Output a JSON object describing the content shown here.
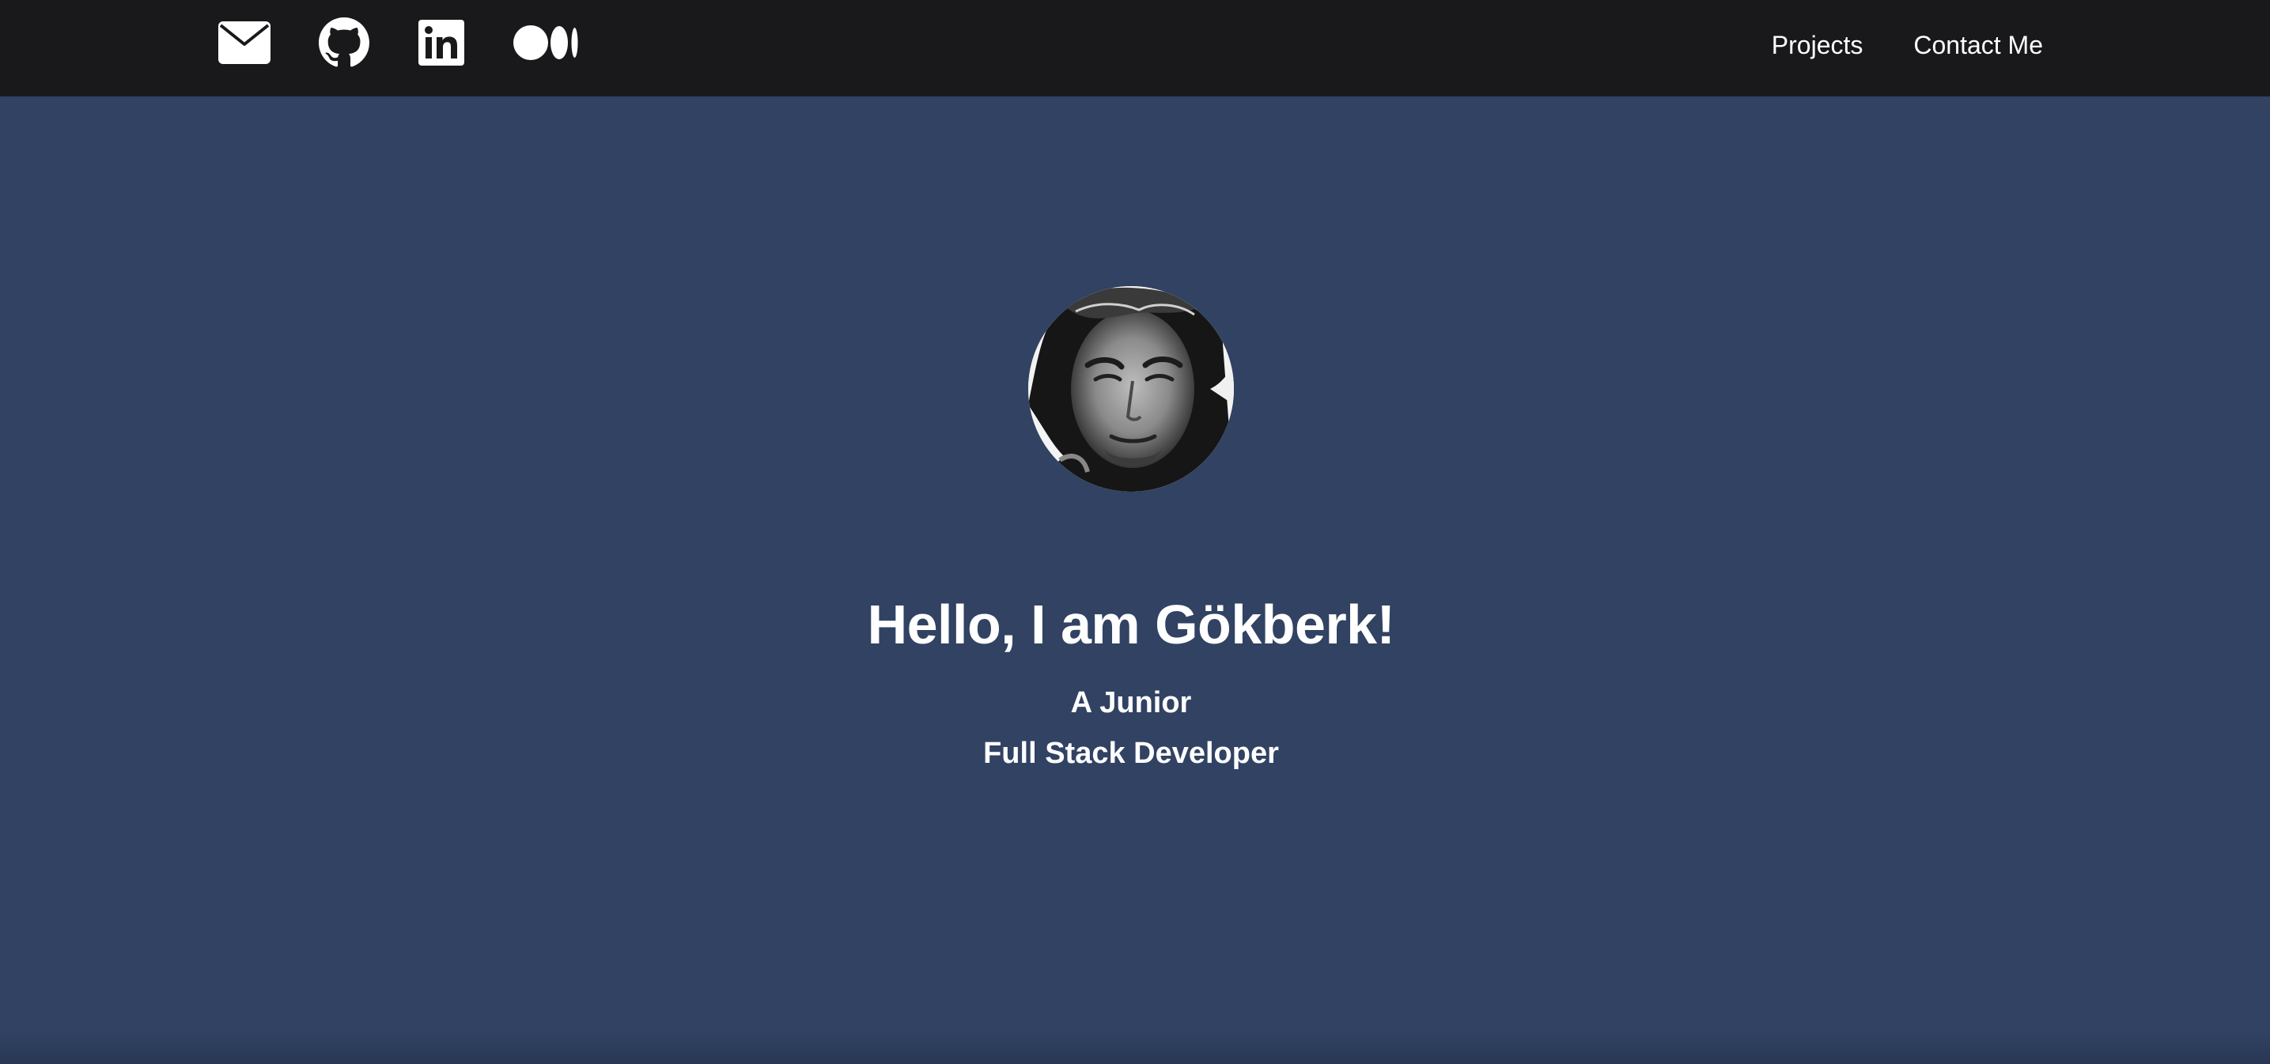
{
  "navbar": {
    "background_color": "#19191b",
    "social_links": [
      {
        "icon": "email-icon"
      },
      {
        "icon": "github-icon"
      },
      {
        "icon": "linkedin-icon"
      },
      {
        "icon": "medium-icon"
      }
    ],
    "links": {
      "projects": "Projects",
      "contact": "Contact Me"
    }
  },
  "hero": {
    "background_color": "#314263",
    "avatar_icon": "profile-photo",
    "title": "Hello, I am Gökberk!",
    "subtitle_line1": "A Junior",
    "subtitle_line2": "Full Stack Developer"
  }
}
